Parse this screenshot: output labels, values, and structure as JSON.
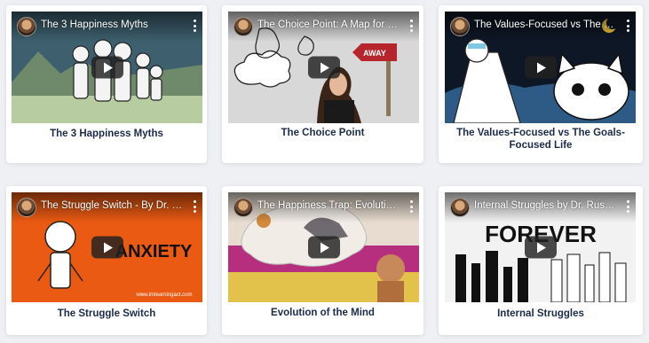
{
  "cards": [
    {
      "video_title": "The 3 Happiness Myths",
      "caption": "The 3 Happiness Myths",
      "colors": {
        "sky": "#3d5f6e",
        "ground": "#b7cda1"
      }
    },
    {
      "video_title": "The Choice Point: A Map for a ...",
      "caption": "The Choice Point",
      "sign_text": "AWAY",
      "colors": {
        "bg": "#d8d8d8",
        "sign": "#b5252b"
      }
    },
    {
      "video_title": "The Values-Focused vs The Go...",
      "caption": "The Values-Focused vs The Goals-Focused Life",
      "colors": {
        "sky": "#0e1726",
        "moon": "#e9c23a"
      }
    },
    {
      "video_title": "The Struggle Switch - By Dr. Rus...",
      "caption": "The Struggle Switch",
      "overlay_word": "ANXIETY",
      "overlay_site": "www.imlearningact.com",
      "colors": {
        "bg": "#ea5a12"
      }
    },
    {
      "video_title": "The Happiness Trap: Evolution ...",
      "caption": "Evolution of the Mind",
      "colors": {
        "bg": "#e8dcd0",
        "band": "#b62f7f",
        "ground": "#e2c24a"
      }
    },
    {
      "video_title": "Internal Struggles by Dr. Russ ...",
      "caption": "Internal Struggles",
      "overlay_word": "FOREVER",
      "colors": {
        "bg": "#f2f2f2"
      }
    }
  ]
}
